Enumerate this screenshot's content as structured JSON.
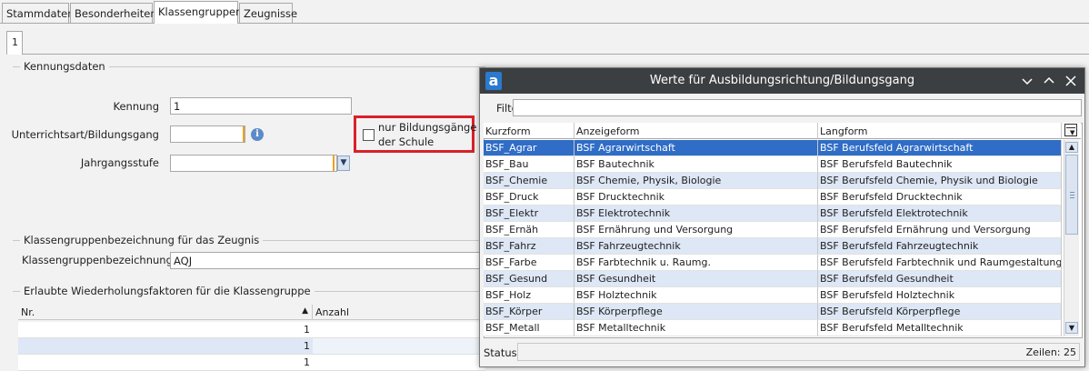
{
  "tabs": [
    "Stammdaten",
    "Besonderheiten",
    "Klassengruppen",
    "Zeugnisse"
  ],
  "subtab": "1",
  "sections": {
    "kennung": "Kennungsdaten",
    "zeugnis": "Klassengruppenbezeichnung für das Zeugnis",
    "faktoren": "Erlaubte Wiederholungsfaktoren für die Klassengruppe"
  },
  "fields": {
    "kennung_label": "Kennung",
    "kennung_value": "1",
    "unterrichtsart_label": "Unterrichtsart/Bildungsgang",
    "unterrichtsart_value": "",
    "jahrgangsstufe_label": "Jahrgangsstufe",
    "jahrgangsstufe_value": "",
    "checkbox_line1": "nur Bildungsgänge",
    "checkbox_line2": "der Schule",
    "klassengruppe_label": "Klassengruppenbezeichnung",
    "klassengruppe_value": "AQJ"
  },
  "faktoren_table": {
    "columns": [
      "Nr.",
      "Anzahl"
    ],
    "rows": [
      "1",
      "1",
      "1"
    ]
  },
  "dialog": {
    "title": "Werte für Ausbildungsrichtung/Bildungsgang",
    "filter_label": "Filter",
    "filter_value": "",
    "columns": [
      "Kurzform",
      "Anzeigeform",
      "Langform"
    ],
    "rows": [
      [
        "BSF_Agrar",
        "BSF Agrarwirtschaft",
        "BSF Berufsfeld Agrarwirtschaft"
      ],
      [
        "BSF_Bau",
        "BSF Bautechnik",
        "BSF Berufsfeld Bautechnik"
      ],
      [
        "BSF_Chemie",
        "BSF Chemie, Physik, Biologie",
        "BSF Berufsfeld Chemie, Physik und Biologie"
      ],
      [
        "BSF_Druck",
        "BSF Drucktechnik",
        "BSF Berufsfeld Drucktechnik"
      ],
      [
        "BSF_Elektr",
        "BSF Elektrotechnik",
        "BSF Berufsfeld Elektrotechnik"
      ],
      [
        "BSF_Ernäh",
        "BSF Ernährung und Versorgung",
        "BSF Berufsfeld Ernährung und Versorgung"
      ],
      [
        "BSF_Fahrz",
        "BSF Fahrzeugtechnik",
        "BSF Berufsfeld Fahrzeugtechnik"
      ],
      [
        "BSF_Farbe",
        "BSF Farbtechnik u. Raumg.",
        "BSF Berufsfeld Farbtechnik und Raumgestaltung"
      ],
      [
        "BSF_Gesund",
        "BSF Gesundheit",
        "BSF Berufsfeld Gesundheit"
      ],
      [
        "BSF_Holz",
        "BSF Holztechnik",
        "BSF Berufsfeld Holztechnik"
      ],
      [
        "BSF_Körper",
        "BSF Körperpflege",
        "BSF Berufsfeld Körperpflege"
      ],
      [
        "BSF_Metall",
        "BSF Metalltechnik",
        "BSF Berufsfeld Metalltechnik"
      ]
    ],
    "selected_row": 0,
    "status_label": "Status",
    "count_text": "Zeilen: 25"
  }
}
